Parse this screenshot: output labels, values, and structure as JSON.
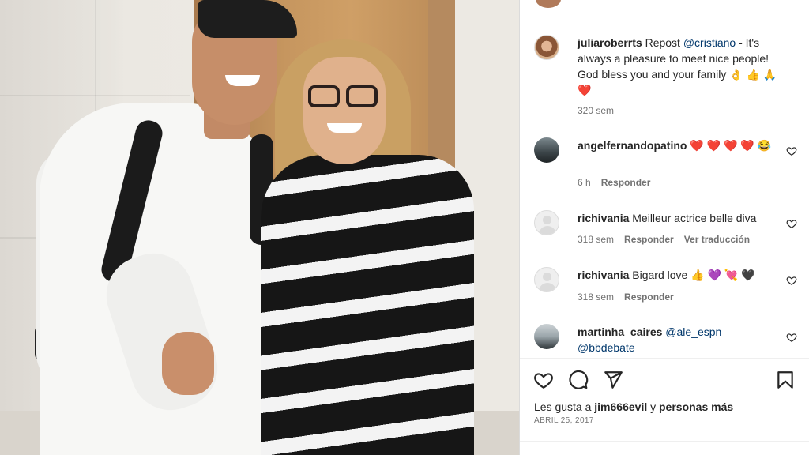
{
  "post": {
    "caption": {
      "username": "juliaroberrts",
      "text_prefix": " Repost ",
      "mention": "@cristiano",
      "text_suffix": " - It's always a pleasure to meet nice people! God bless you and your family 👌 👍 🙏 ❤️",
      "time": "320 sem"
    },
    "comments": [
      {
        "username": "angelfernandopatino",
        "text": " ❤️ ❤️ ❤️ ❤️ 😂",
        "time": "6 h",
        "reply": "Responder"
      },
      {
        "username": "richivania",
        "text": " Meilleur actrice belle diva",
        "time": "318 sem",
        "reply": "Responder",
        "translate": "Ver traducción"
      },
      {
        "username": "richivania",
        "text": " Bigard love 👍 💜 💘 🖤",
        "time": "318 sem",
        "reply": "Responder"
      },
      {
        "username": "martinha_caires",
        "mention1": " @ale_espn",
        "mention2": "@bbdebate"
      }
    ],
    "likes": {
      "prefix": "Les gusta a ",
      "user": "jim666evil",
      "middle": " y ",
      "suffix": "personas más"
    },
    "date": "ABRIL 25, 2017",
    "icons": {
      "like": "heart-outline-icon",
      "comment": "comment-bubble-icon",
      "share": "paper-plane-icon",
      "save": "bookmark-icon"
    }
  }
}
